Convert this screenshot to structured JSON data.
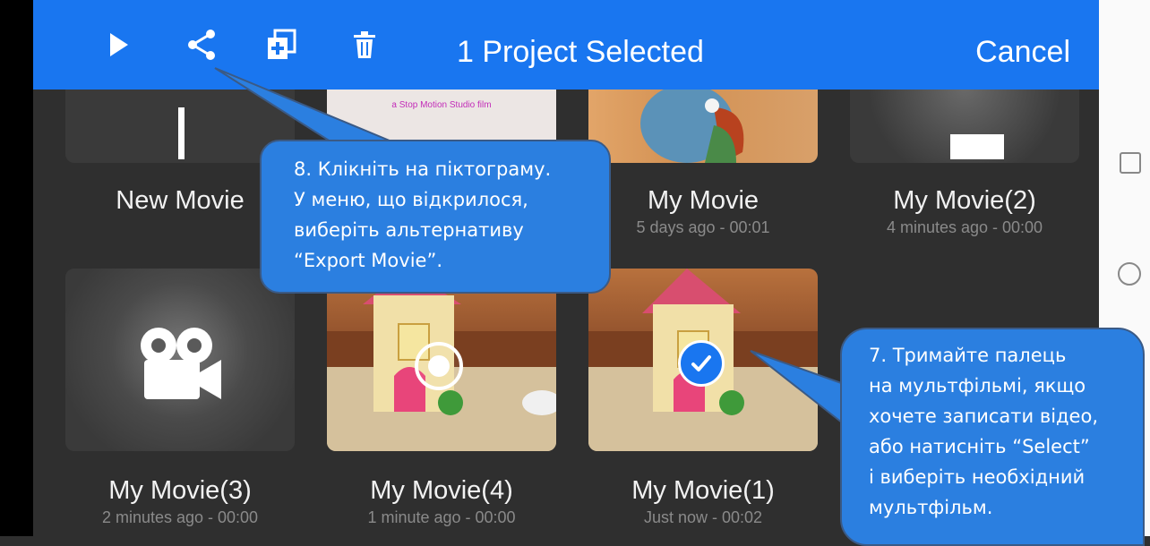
{
  "toolbar": {
    "title": "1 Project Selected",
    "cancel_label": "Cancel",
    "icons": [
      "play-icon",
      "share-icon",
      "duplicate-icon",
      "trash-icon"
    ],
    "background": "#1976f0"
  },
  "projects": [
    {
      "name": "New Movie",
      "meta": ""
    },
    {
      "name": "My Movie",
      "meta": "5 days ago - 00:01"
    },
    {
      "name": "My Movie(2)",
      "meta": "4 minutes ago - 00:00"
    },
    {
      "name": "My Movie(3)",
      "meta": "2 minutes ago - 00:00"
    },
    {
      "name": "My Movie(4)",
      "meta": "1 minute ago - 00:00"
    },
    {
      "name": "My Movie(1)",
      "meta": "Just now - 00:02",
      "selected": true
    }
  ],
  "thumb_caption": "a Stop Motion Studio film",
  "callouts": {
    "share": {
      "lines": [
        "8. Клікніть на піктограму.",
        "У меню, що відкрилося,",
        "виберіть альтернативу",
        "“Export Movie”."
      ]
    },
    "select": {
      "lines": [
        "7. Тримайте палець",
        "на мультфільмі, якщо",
        "хочете записати відео,",
        "або натисніть “Select”",
        "і виберіть необхідний",
        "мультфільм."
      ]
    }
  }
}
